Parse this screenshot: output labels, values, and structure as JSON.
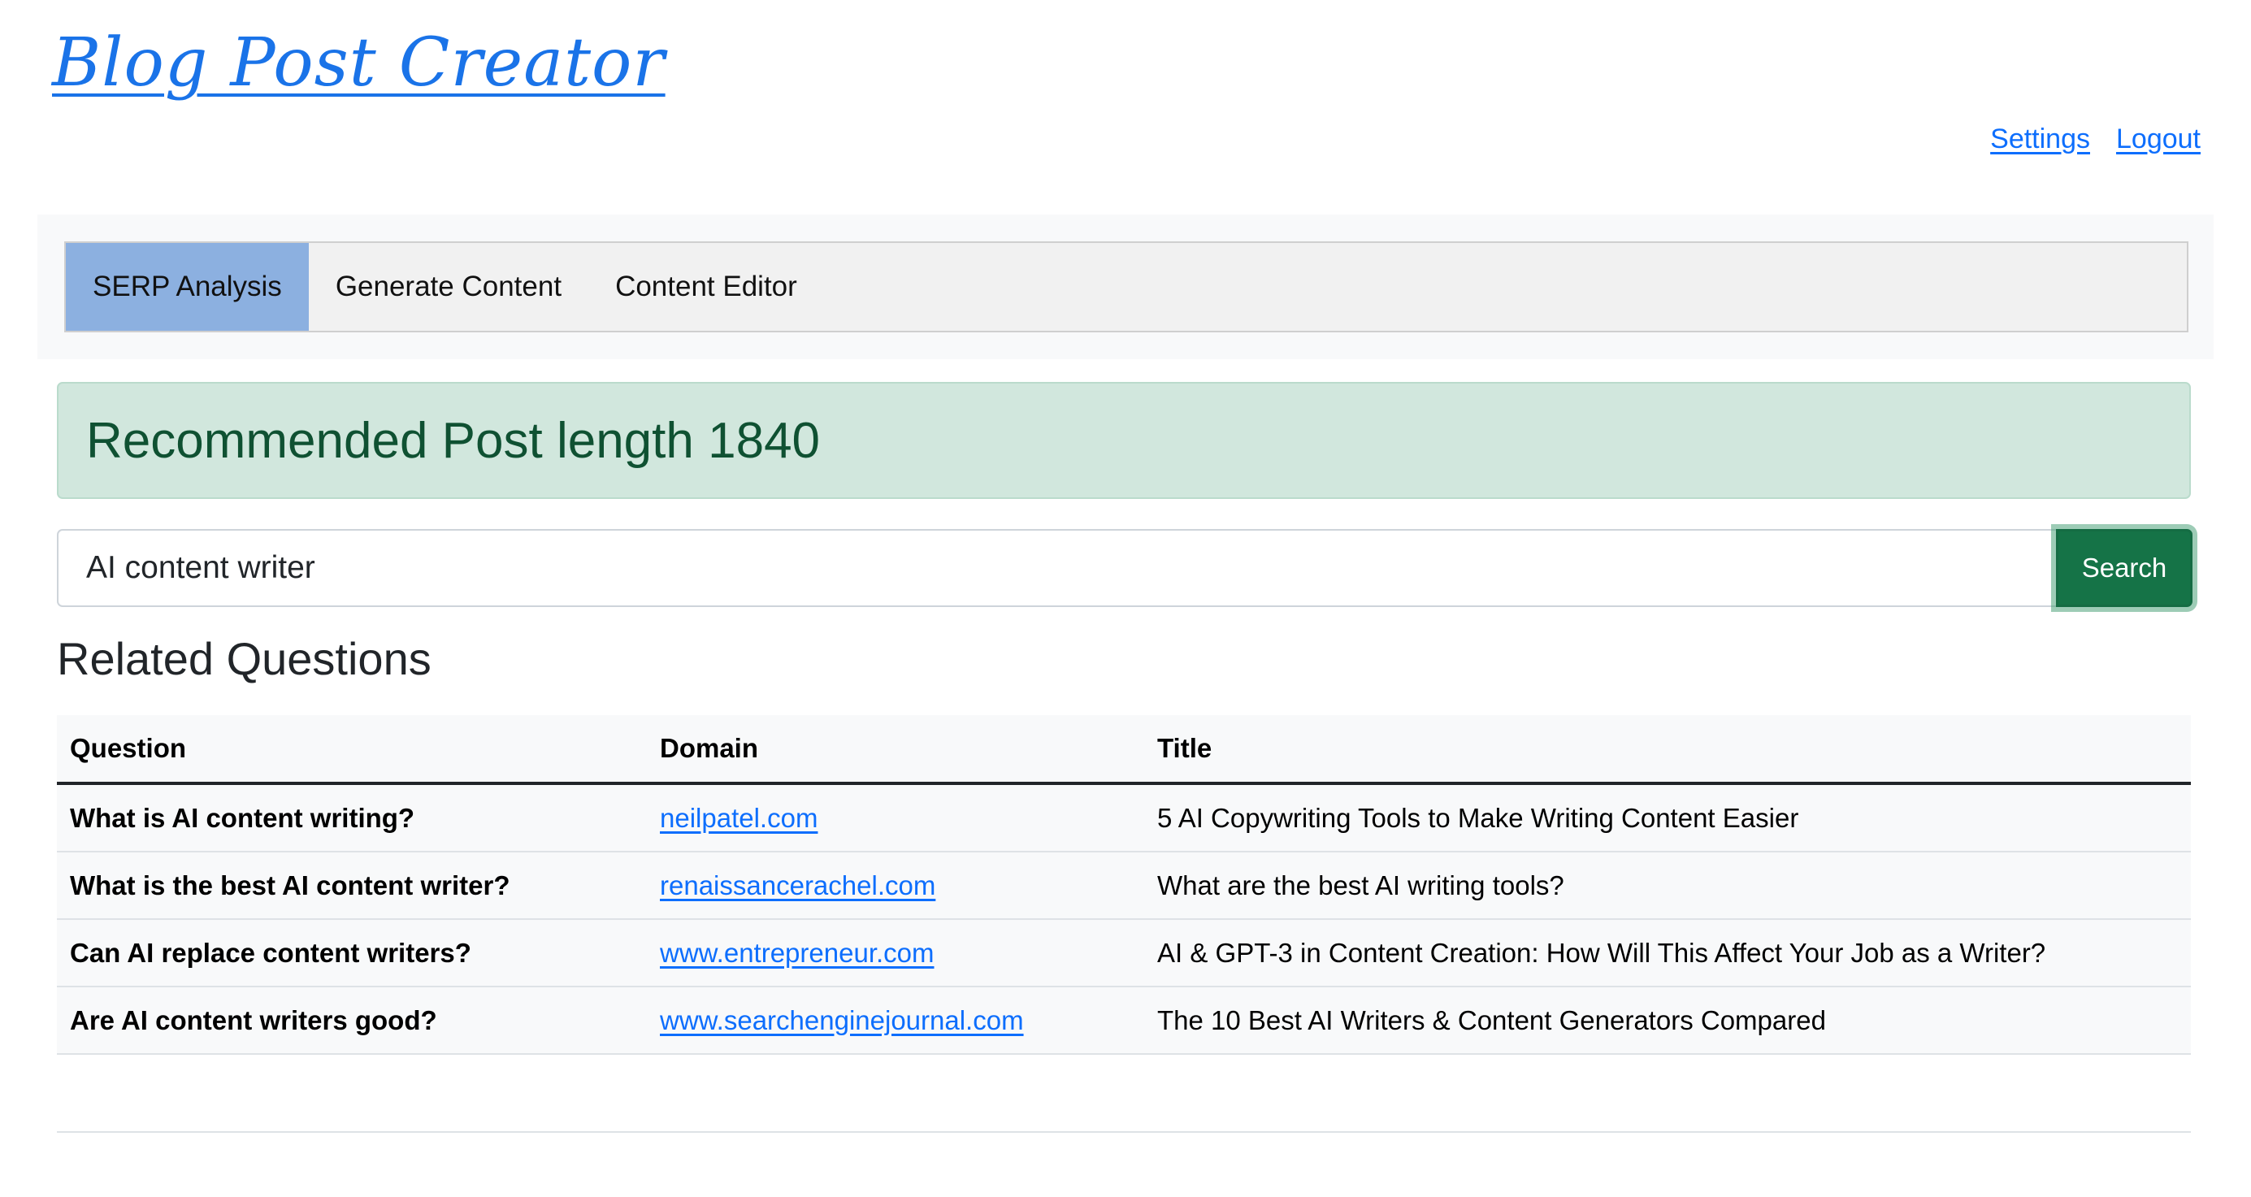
{
  "header": {
    "logo_text": "Blog Post Creator",
    "links": {
      "settings": "Settings",
      "logout": "Logout"
    }
  },
  "nav": {
    "tabs": [
      {
        "label": "SERP Analysis",
        "active": true
      },
      {
        "label": "Generate Content",
        "active": false
      },
      {
        "label": "Content Editor",
        "active": false
      }
    ]
  },
  "alert": {
    "text": "Recommended Post length 1840"
  },
  "search": {
    "value": "AI content writer",
    "button_label": "Search"
  },
  "related": {
    "title": "Related Questions",
    "columns": [
      "Question",
      "Domain",
      "Title"
    ],
    "rows": [
      {
        "question": "What is AI content writing?",
        "domain": "neilpatel.com",
        "title": "5 AI Copywriting Tools to Make Writing Content Easier"
      },
      {
        "question": "What is the best AI content writer?",
        "domain": "renaissancerachel.com",
        "title": "What are the best AI writing tools?"
      },
      {
        "question": "Can AI replace content writers?",
        "domain": "www.entrepreneur.com",
        "title": "AI & GPT-3 in Content Creation: How Will This Affect Your Job as a Writer?"
      },
      {
        "question": "Are AI content writers good?",
        "domain": "www.searchenginejournal.com",
        "title": "The 10 Best AI Writers & Content Generators Compared"
      }
    ]
  },
  "colors": {
    "link": "#0d6efd",
    "logo": "#1a73e8",
    "active_tab": "#8cb0e0",
    "alert_bg": "#d1e7dd",
    "alert_text": "#0f5132",
    "search_button": "#157347"
  }
}
